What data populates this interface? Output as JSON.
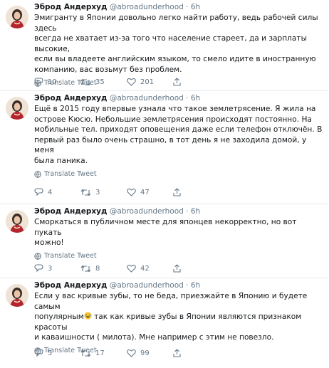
{
  "tweets": [
    {
      "name": "Эброд Андерхуд",
      "handle": "@abroadunderhood",
      "separator": "·",
      "time": "6h",
      "lines": [
        "Эмигранту в Японии довольно легко найти работу, ведь рабочей силы здесь",
        "всегда не хватает из-за того что население стареет, да и зарплаты высокие,",
        "если вы владеете английским языком, то смело идите в иностранную",
        "компанию, вас возьмут без проблем."
      ],
      "translate_label": "Translate Tweet",
      "replies": "10",
      "retweets": "35",
      "likes": "201"
    },
    {
      "name": "Эброд Андерхуд",
      "handle": "@abroadunderhood",
      "separator": "·",
      "time": "6h",
      "lines": [
        "Ещё в 2015 году впервые узнала что такое  землетрясение. Я жила  на",
        "острове Кюсю. Небольшие землетрясения происходят постоянно. На",
        "мобильные тел. приходят оповещения даже если телефон отключён. В",
        "первый раз было очень страшно,  в тот день я не заходила домой, у меня",
        "была паника."
      ],
      "translate_label": "Translate Tweet",
      "replies": "4",
      "retweets": "3",
      "likes": "47"
    },
    {
      "name": "Эброд Андерхуд",
      "handle": "@abroadunderhood",
      "separator": "·",
      "time": "6h",
      "lines": [
        "Сморкаться в публичном месте для японцев некорректно, но вот пукать",
        "можно!"
      ],
      "translate_label": "Translate Tweet",
      "replies": "3",
      "retweets": "8",
      "likes": "42"
    },
    {
      "name": "Эброд Андерхуд",
      "handle": "@abroadunderhood",
      "separator": "·",
      "time": "6h",
      "lines": [
        "Если у вас кривые зубы, то не беда, приезжайте в Японию и будете самым",
        "популярным",
        "и каваишности ( милота). Мне например с этим не повезло."
      ],
      "line2_after_emoji": " так как кривые  зубы в Японии являются признаком красоты",
      "translate_label": "Translate Tweet",
      "replies": "5",
      "retweets": "17",
      "likes": "99"
    }
  ],
  "icons": {
    "reply": "reply-icon",
    "retweet": "retweet-icon",
    "like": "heart-icon",
    "share": "share-icon",
    "translate": "globe-icon",
    "emoji": "laughing-emoji-icon"
  },
  "colors": {
    "name": "#14171a",
    "muted": "#657786",
    "divider": "#e6ecf0",
    "emoji": "#f5c533"
  }
}
